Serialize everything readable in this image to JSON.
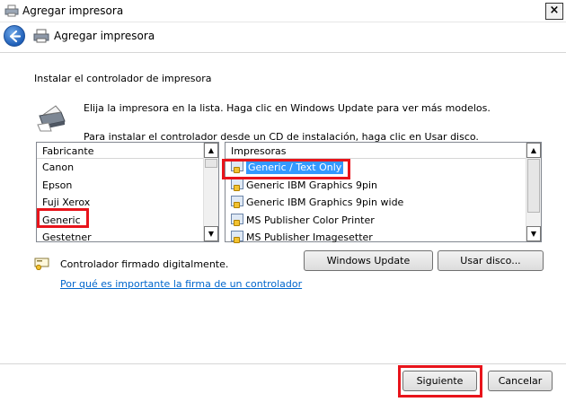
{
  "window": {
    "title": "Agregar impresora",
    "close_glyph": "×"
  },
  "navbar": {
    "title": "Agregar impresora"
  },
  "content": {
    "heading": "Instalar el controlador de impresora",
    "instruction_1": "Elija la impresora en la lista. Haga clic en Windows Update para ver más modelos.",
    "instruction_2": "Para instalar el controlador desde un CD de instalación, haga clic en Usar disco."
  },
  "manufacturers": {
    "header": "Fabricante",
    "items": [
      "Canon",
      "Epson",
      "Fuji Xerox",
      "Generic",
      "Gestetner"
    ],
    "selected": "Generic"
  },
  "printers": {
    "header": "Impresoras",
    "items": [
      "Generic / Text Only",
      "Generic IBM Graphics 9pin",
      "Generic IBM Graphics 9pin wide",
      "MS Publisher Color Printer",
      "MS Publisher Imagesetter"
    ],
    "selected": "Generic / Text Only"
  },
  "signing": {
    "status": "Controlador firmado digitalmente.",
    "link": "Por qué es importante la firma de un controlador"
  },
  "buttons": {
    "windows_update": "Windows Update",
    "have_disk": "Usar disco...",
    "next": "Siguiente",
    "cancel": "Cancelar"
  },
  "icons": {
    "app": "add-printer-icon",
    "back": "back-arrow-icon",
    "nav_printer": "printer-icon",
    "big_printer": "printer-icon",
    "driver": "driver-icon",
    "signed": "signed-driver-icon"
  },
  "colors": {
    "selection": "#3399ff",
    "highlight": "#e8141b",
    "link": "#0066cc"
  }
}
